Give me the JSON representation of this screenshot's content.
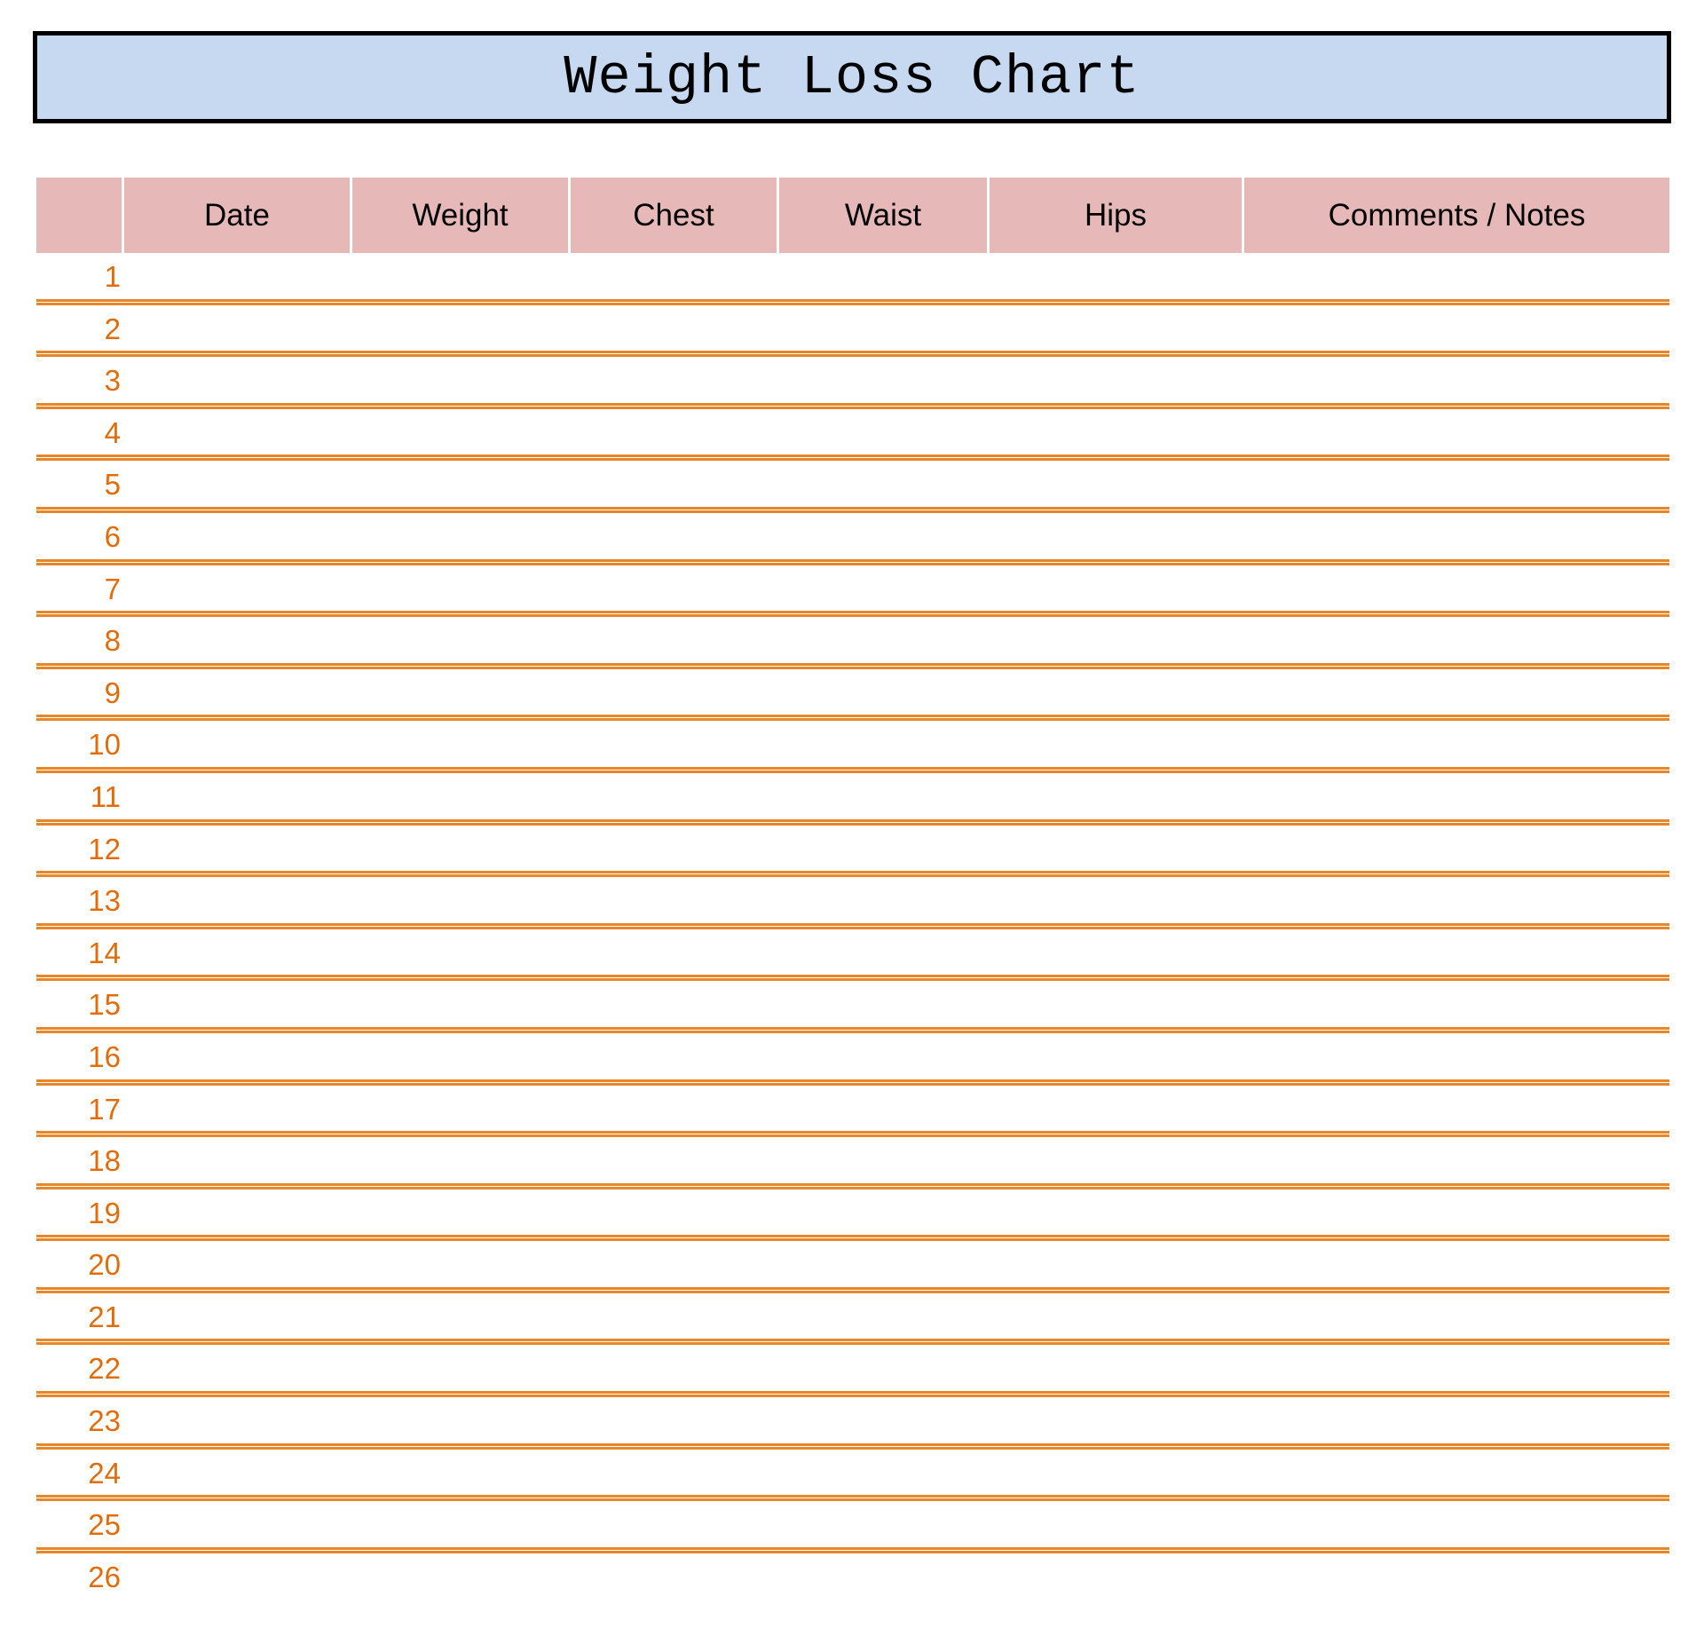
{
  "title": "Weight Loss Chart",
  "headers": [
    "",
    "Date",
    "Weight",
    "Chest",
    "Waist",
    "Hips",
    "Comments / Notes"
  ],
  "row_numbers": [
    "1",
    "2",
    "3",
    "4",
    "5",
    "6",
    "7",
    "8",
    "9",
    "10",
    "11",
    "12",
    "13",
    "14",
    "15",
    "16",
    "17",
    "18",
    "19",
    "20",
    "21",
    "22",
    "23",
    "24",
    "25",
    "26"
  ],
  "colors": {
    "title_bg": "#c6d9f1",
    "header_bg": "#e6b9b8",
    "row_accent": "#e36c09",
    "row_line": "#e8872a"
  }
}
